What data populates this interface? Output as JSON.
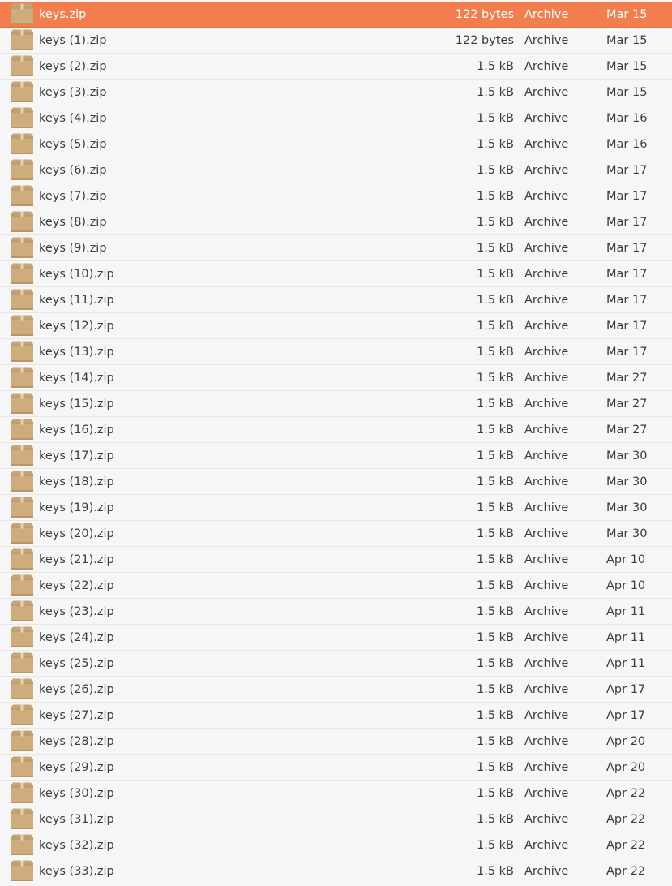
{
  "file_list": {
    "icon": "archive-package-icon",
    "selected_index": 0,
    "colors": {
      "selection": "#f37e4d",
      "background": "#f6f6f6",
      "text": "#3c3c3c",
      "selected_text": "#ffffff"
    },
    "rows": [
      {
        "name": "keys.zip",
        "size": "122 bytes",
        "type": "Archive",
        "modified": "Mar 15"
      },
      {
        "name": "keys (1).zip",
        "size": "122 bytes",
        "type": "Archive",
        "modified": "Mar 15"
      },
      {
        "name": "keys (2).zip",
        "size": "1.5 kB",
        "type": "Archive",
        "modified": "Mar 15"
      },
      {
        "name": "keys (3).zip",
        "size": "1.5 kB",
        "type": "Archive",
        "modified": "Mar 15"
      },
      {
        "name": "keys (4).zip",
        "size": "1.5 kB",
        "type": "Archive",
        "modified": "Mar 16"
      },
      {
        "name": "keys (5).zip",
        "size": "1.5 kB",
        "type": "Archive",
        "modified": "Mar 16"
      },
      {
        "name": "keys (6).zip",
        "size": "1.5 kB",
        "type": "Archive",
        "modified": "Mar 17"
      },
      {
        "name": "keys (7).zip",
        "size": "1.5 kB",
        "type": "Archive",
        "modified": "Mar 17"
      },
      {
        "name": "keys (8).zip",
        "size": "1.5 kB",
        "type": "Archive",
        "modified": "Mar 17"
      },
      {
        "name": "keys (9).zip",
        "size": "1.5 kB",
        "type": "Archive",
        "modified": "Mar 17"
      },
      {
        "name": "keys (10).zip",
        "size": "1.5 kB",
        "type": "Archive",
        "modified": "Mar 17"
      },
      {
        "name": "keys (11).zip",
        "size": "1.5 kB",
        "type": "Archive",
        "modified": "Mar 17"
      },
      {
        "name": "keys (12).zip",
        "size": "1.5 kB",
        "type": "Archive",
        "modified": "Mar 17"
      },
      {
        "name": "keys (13).zip",
        "size": "1.5 kB",
        "type": "Archive",
        "modified": "Mar 17"
      },
      {
        "name": "keys (14).zip",
        "size": "1.5 kB",
        "type": "Archive",
        "modified": "Mar 27"
      },
      {
        "name": "keys (15).zip",
        "size": "1.5 kB",
        "type": "Archive",
        "modified": "Mar 27"
      },
      {
        "name": "keys (16).zip",
        "size": "1.5 kB",
        "type": "Archive",
        "modified": "Mar 27"
      },
      {
        "name": "keys (17).zip",
        "size": "1.5 kB",
        "type": "Archive",
        "modified": "Mar 30"
      },
      {
        "name": "keys (18).zip",
        "size": "1.5 kB",
        "type": "Archive",
        "modified": "Mar 30"
      },
      {
        "name": "keys (19).zip",
        "size": "1.5 kB",
        "type": "Archive",
        "modified": "Mar 30"
      },
      {
        "name": "keys (20).zip",
        "size": "1.5 kB",
        "type": "Archive",
        "modified": "Mar 30"
      },
      {
        "name": "keys (21).zip",
        "size": "1.5 kB",
        "type": "Archive",
        "modified": "Apr 10"
      },
      {
        "name": "keys (22).zip",
        "size": "1.5 kB",
        "type": "Archive",
        "modified": "Apr 10"
      },
      {
        "name": "keys (23).zip",
        "size": "1.5 kB",
        "type": "Archive",
        "modified": "Apr 11"
      },
      {
        "name": "keys (24).zip",
        "size": "1.5 kB",
        "type": "Archive",
        "modified": "Apr 11"
      },
      {
        "name": "keys (25).zip",
        "size": "1.5 kB",
        "type": "Archive",
        "modified": "Apr 11"
      },
      {
        "name": "keys (26).zip",
        "size": "1.5 kB",
        "type": "Archive",
        "modified": "Apr 17"
      },
      {
        "name": "keys (27).zip",
        "size": "1.5 kB",
        "type": "Archive",
        "modified": "Apr 17"
      },
      {
        "name": "keys (28).zip",
        "size": "1.5 kB",
        "type": "Archive",
        "modified": "Apr 20"
      },
      {
        "name": "keys (29).zip",
        "size": "1.5 kB",
        "type": "Archive",
        "modified": "Apr 20"
      },
      {
        "name": "keys (30).zip",
        "size": "1.5 kB",
        "type": "Archive",
        "modified": "Apr 22"
      },
      {
        "name": "keys (31).zip",
        "size": "1.5 kB",
        "type": "Archive",
        "modified": "Apr 22"
      },
      {
        "name": "keys (32).zip",
        "size": "1.5 kB",
        "type": "Archive",
        "modified": "Apr 22"
      },
      {
        "name": "keys (33).zip",
        "size": "1.5 kB",
        "type": "Archive",
        "modified": "Apr 22"
      }
    ]
  }
}
